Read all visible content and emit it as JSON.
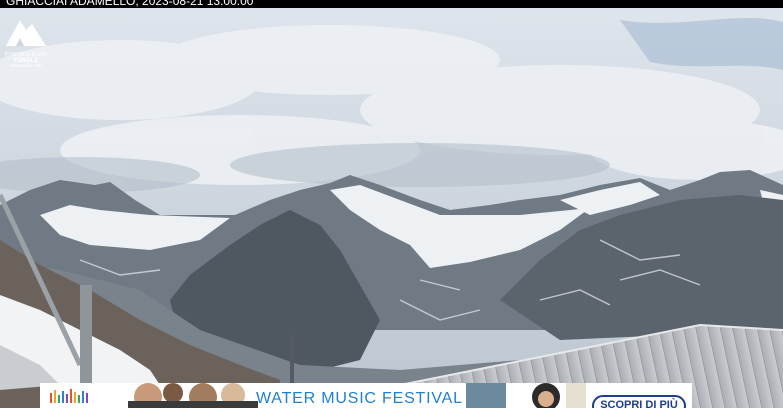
{
  "overlay": {
    "timestamp_text": "GHIACCIAI ADAMELLO, 2023-08-21 13:00:00"
  },
  "logo": {
    "line1": "PONTEDILEGNO",
    "line2": "TONALE",
    "line3": "Adamello Ski"
  },
  "banner": {
    "title": "WATER MUSIC FESTIVAL",
    "cta_label": "SCOPRI DI PIÙ",
    "accent_color": "#1f7fd0",
    "cta_border_color": "#1d3e8c"
  },
  "scene": {
    "description_icons": [
      "mountain-range",
      "glacier",
      "metal-roof",
      "antenna-pole"
    ]
  }
}
